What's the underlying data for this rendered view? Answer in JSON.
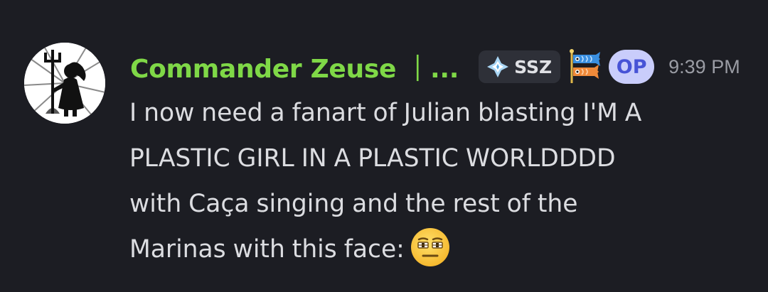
{
  "message": {
    "author": {
      "display_name": "Commander Zeuse ｜...",
      "name_color": "#7fd847",
      "avatar_icon": "black-silhouette-avatar"
    },
    "clan_tag": {
      "icon": "diamond-sparkle-icon",
      "label": "SSZ"
    },
    "role_icon": "koinobori-carp-streamer-icon",
    "op_badge": "OP",
    "timestamp": "9:39 PM",
    "content_lines": [
      "I now need a fanart of Julian blasting I'M A",
      "PLASTIC GIRL IN A PLASTIC WORLDDDD",
      "with Caça singing and the rest of the",
      "Marinas with this face:"
    ],
    "emoji": "face-with-rolling-eyes-emoji"
  },
  "colors": {
    "background": "#1c1d23",
    "message_text": "#dcdde1",
    "timestamp": "#9a9ca4",
    "op_badge_bg": "#c9cdfb",
    "op_badge_text": "#4753d6",
    "clan_tag_bg": "#2e3038"
  }
}
